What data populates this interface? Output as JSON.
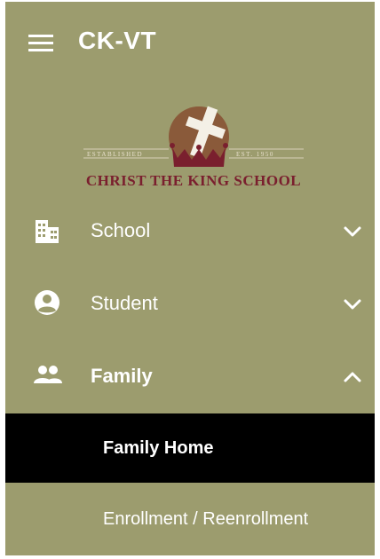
{
  "header": {
    "app_title": "CK-VT",
    "menu_icon": "hamburger-menu-icon"
  },
  "logo": {
    "school_name": "CHRIST THE KING SCHOOL",
    "left_text": "ESTABLISHED",
    "right_text": "EST. 1950"
  },
  "nav": {
    "items": [
      {
        "label": "School",
        "icon": "building-icon",
        "chevron": "chevron-down-icon",
        "expanded": false
      },
      {
        "label": "Student",
        "icon": "account-circle-icon",
        "chevron": "chevron-down-icon",
        "expanded": false
      },
      {
        "label": "Family",
        "icon": "people-icon",
        "chevron": "chevron-up-icon",
        "expanded": true
      }
    ],
    "family_sub": [
      {
        "label": "Family Home",
        "active": true
      },
      {
        "label": "Enrollment / Reenrollment",
        "active": false
      }
    ]
  },
  "colors": {
    "sidebar_bg": "#9c9c6e",
    "active_bg": "#000000",
    "text": "#ffffff",
    "logo_maroon": "#7a1f2e",
    "logo_brown": "#8a5a3a"
  }
}
